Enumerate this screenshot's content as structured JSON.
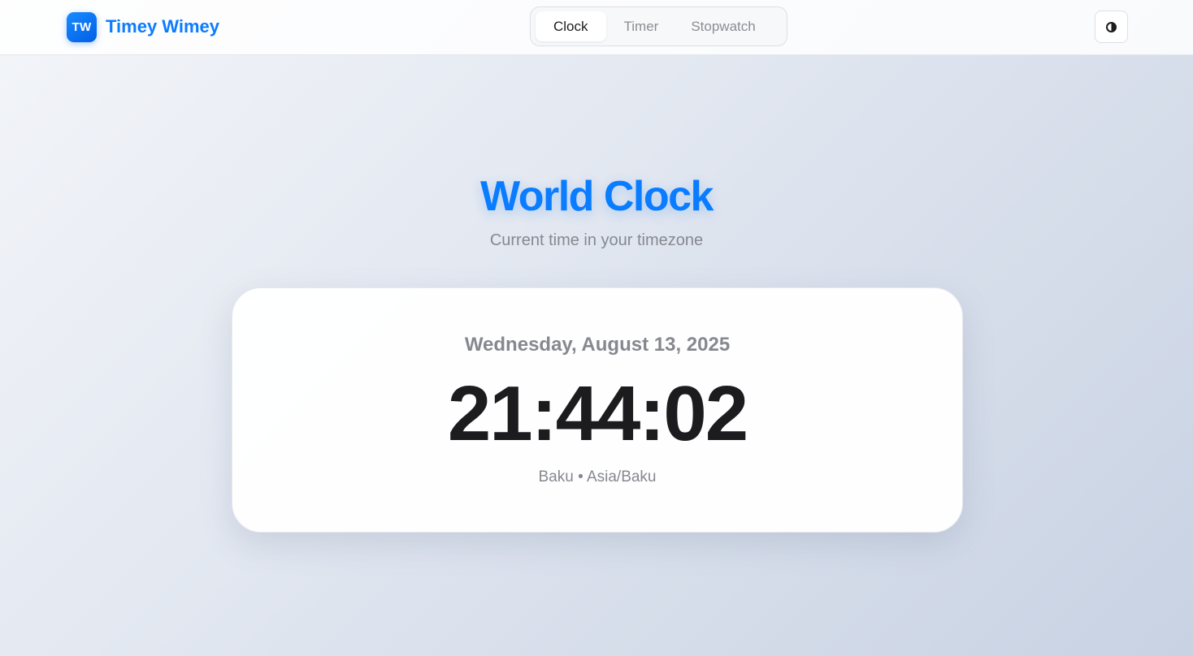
{
  "brand": {
    "logo_text": "TW",
    "name": "Timey Wimey"
  },
  "nav": {
    "tabs": [
      {
        "label": "Clock"
      },
      {
        "label": "Timer"
      },
      {
        "label": "Stopwatch"
      }
    ]
  },
  "theme_toggle": {
    "icon": "contrast-icon"
  },
  "hero": {
    "title": "World Clock",
    "subtitle": "Current time in your timezone"
  },
  "clock": {
    "date": "Wednesday, August 13, 2025",
    "time": "21:44:02",
    "location": "Baku • Asia/Baku"
  },
  "colors": {
    "accent": "#0a7cff",
    "text": "#1c1c1e",
    "muted": "#86888f"
  }
}
